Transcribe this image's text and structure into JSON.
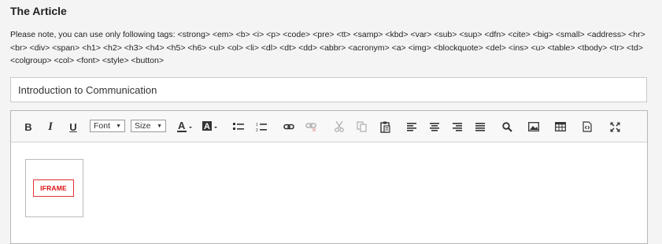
{
  "section": {
    "title": "The Article",
    "note": "Please note, you can use only following tags: <strong> <em> <b> <i> <p> <code> <pre> <tt> <samp> <kbd> <var> <sub> <sup> <dfn> <cite> <big> <small> <address> <hr> <br> <div> <span> <h1> <h2> <h3> <h4> <h5> <h6> <ul> <ol> <li> <dl> <dt> <dd> <abbr> <acronym> <a> <img> <blockquote> <del> <ins> <u> <table> <tbody> <tr> <td> <colgroup> <col> <font> <style> <button>"
  },
  "title_field": {
    "value": "Introduction to Communication"
  },
  "toolbar": {
    "bold_label": "B",
    "italic_label": "I",
    "underline_label": "U",
    "font_combo": "Font",
    "size_combo": "Size",
    "text_color_label": "A",
    "bg_color_label": "A",
    "icons": [
      "bold-icon",
      "italic-icon",
      "underline-icon",
      "font-combo",
      "size-combo",
      "text-color-icon",
      "background-color-icon",
      "bulleted-list-icon",
      "numbered-list-icon",
      "link-icon",
      "unlink-icon",
      "cut-icon",
      "copy-icon",
      "paste-icon",
      "align-left-icon",
      "align-center-icon",
      "align-right-icon",
      "justify-icon",
      "search-icon",
      "image-icon",
      "table-icon",
      "source-icon",
      "maximize-icon"
    ]
  },
  "content": {
    "iframe_label": "IFRAME"
  },
  "colors": {
    "page_bg": "#f4f4f4",
    "toolbar_bg": "#f8f8f8",
    "iframe_badge": "#dd2222"
  }
}
